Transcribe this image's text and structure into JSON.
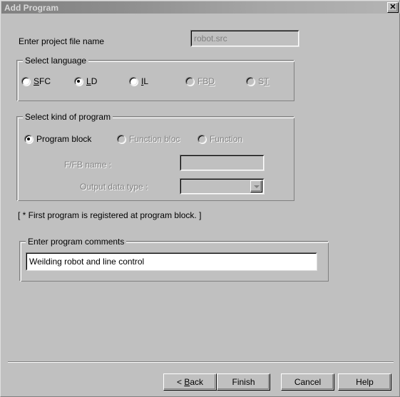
{
  "window": {
    "title": "Add Program",
    "close_label": "✕"
  },
  "project": {
    "label": "Enter project file name",
    "file_value": "robot.src",
    "file_placeholder": ""
  },
  "language_group": {
    "title": "Select language",
    "options": [
      {
        "label_before": "",
        "mnemonic": "S",
        "label_after": "FC",
        "checked": false,
        "disabled": false
      },
      {
        "label_before": "",
        "mnemonic": "L",
        "label_after": "D",
        "checked": true,
        "disabled": false
      },
      {
        "label_before": "",
        "mnemonic": "I",
        "label_after": "L",
        "checked": false,
        "disabled": false
      },
      {
        "label_before": "FB",
        "mnemonic": "D",
        "label_after": "",
        "checked": false,
        "disabled": true
      },
      {
        "label_before": "S",
        "mnemonic": "T",
        "label_after": "",
        "checked": false,
        "disabled": true
      }
    ]
  },
  "kind_group": {
    "title": "Select kind of program",
    "options": [
      {
        "label": "Program block",
        "checked": true,
        "disabled": false
      },
      {
        "label": "Function bloc",
        "checked": false,
        "disabled": true
      },
      {
        "label": "Function",
        "checked": false,
        "disabled": true
      }
    ],
    "ffb_name_label": "F/FB name :",
    "ffb_name_value": "",
    "output_type_label": "Output data type :",
    "output_type_value": ""
  },
  "note": "[ * First program is registered at program block. ]",
  "comments_group": {
    "title": "Enter program comments",
    "value": "Weilding robot and line control"
  },
  "buttons": {
    "back_prefix": "< ",
    "back_mnemonic": "B",
    "back_suffix": "ack",
    "finish": "Finish",
    "cancel": "Cancel",
    "help": "Help"
  }
}
